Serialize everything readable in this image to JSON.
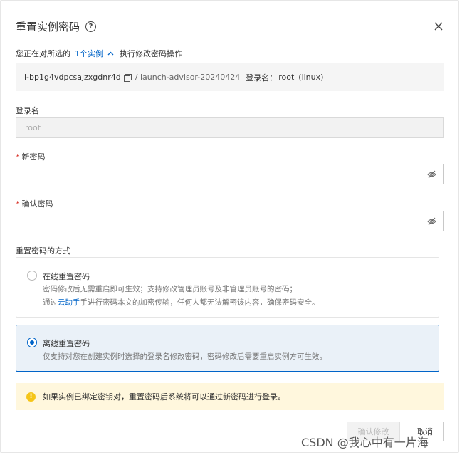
{
  "dialog": {
    "title": "重置实例密码",
    "help_symbol": "?",
    "subtitle": {
      "prefix": "您正在对所选的",
      "link": "1个实例",
      "chevron": "^",
      "suffix": "执行修改密码操作"
    },
    "instance": {
      "id": "i-bp1g4vdpcsajzxgdnr4d",
      "name": "/ launch-advisor-20240424",
      "login_label": "登录名：",
      "login_value": "root",
      "os": "(linux)"
    },
    "login_name": {
      "label": "登录名",
      "placeholder": "root"
    },
    "new_password": {
      "required_mark": "*",
      "label": "新密码",
      "value": ""
    },
    "confirm_password": {
      "required_mark": "*",
      "label": "确认密码",
      "value": ""
    },
    "reset_method": {
      "label": "重置密码的方式",
      "online": {
        "title": "在线重置密码",
        "desc1": "密码修改后无需重启即可生效；支持修改管理员账号及非管理员账号的密码；",
        "desc2_prefix": "通过",
        "desc2_link": "云助手",
        "desc2_suffix": "手进行密码本文的加密传输，任何人都无法解密该内容，确保密码安全。",
        "selected": false
      },
      "offline": {
        "title": "离线重置密码",
        "desc": "仅支持对您在创建实例时选择的登录名修改密码，密码修改后需要重启实例方可生效。",
        "selected": true
      }
    },
    "warning": {
      "icon_symbol": "!",
      "text": "如果实例已绑定密钥对，重置密码后系统将可以通过新密码进行登录。"
    },
    "buttons": {
      "confirm": "确认修改",
      "cancel": "取消"
    },
    "accent_color": "#0064c8",
    "warning_bg": "#fff7dd"
  },
  "watermark": "CSDN @我心中有一片海"
}
